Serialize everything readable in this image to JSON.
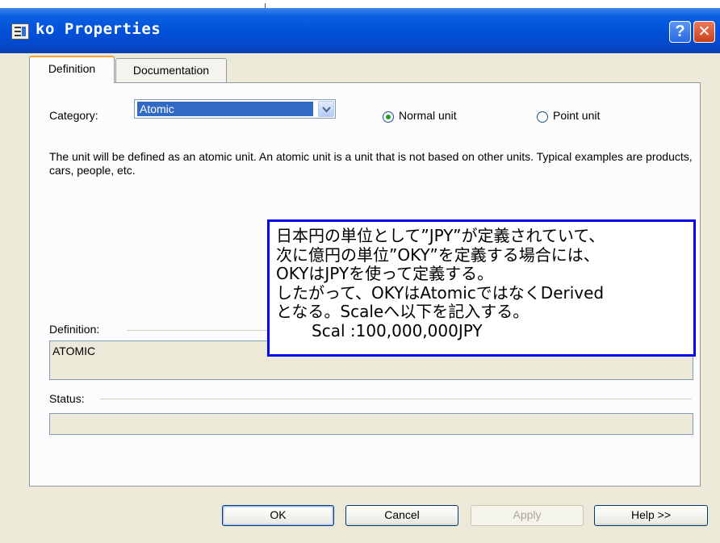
{
  "window": {
    "title": "ko Properties",
    "help_glyph": "?",
    "close_glyph": "✕"
  },
  "tabs": [
    {
      "label": "Definition",
      "active": true
    },
    {
      "label": "Documentation",
      "active": false
    }
  ],
  "category": {
    "label": "Category:",
    "value": "Atomic"
  },
  "unit_type": {
    "normal_label": "Normal unit",
    "point_label": "Point unit",
    "selected": "Normal unit"
  },
  "description": "The unit will be defined as an atomic unit. An atomic unit is a unit that is not based on other units. Typical examples are products, cars, people, etc.",
  "definition": {
    "label": "Definition:",
    "value": "ATOMIC"
  },
  "status": {
    "label": "Status:",
    "value": ""
  },
  "annotation": {
    "lines": [
      "日本円の単位として”JPY”が定義されていて、",
      "次に億円の単位”OKY”を定義する場合には、",
      "OKYはJPYを使って定義する。",
      "したがって、OKYはAtomicではなくDerived",
      "となる。Scaleへ以下を記入する。",
      "Scal :100,000,000JPY"
    ],
    "border_color": "#0000ee"
  },
  "buttons": {
    "ok": "OK",
    "cancel": "Cancel",
    "apply": "Apply",
    "help": "Help >>"
  },
  "colors": {
    "titlebar": "#0050d8",
    "selection": "#316ac5",
    "window_bg": "#ece9d8"
  }
}
